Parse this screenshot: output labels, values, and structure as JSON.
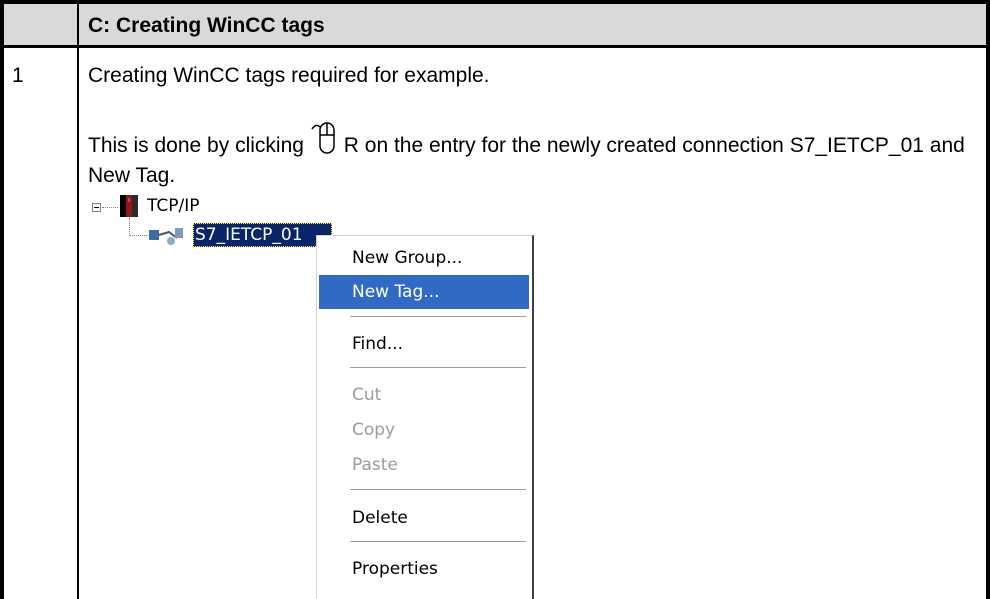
{
  "table": {
    "header_title": "C: Creating WinCC tags",
    "step_number": "1",
    "line1": "Creating WinCC tags required for example.",
    "line2_before": "This is done by clicking ",
    "line2_after": "R on the entry for the newly created connection S7_IETCP_01 and New Tag."
  },
  "tree": {
    "root_label": "TCP/IP",
    "child_label": "S7_IETCP_01",
    "root_icon": "network-unit-icon",
    "child_icon": "connection-icon",
    "expander": "collapse-minus-icon"
  },
  "context_menu": {
    "items": [
      {
        "label": "New Group...",
        "state": "normal"
      },
      {
        "label": "New Tag...",
        "state": "highlighted"
      },
      {
        "label": "Find...",
        "state": "normal"
      },
      {
        "label": "Cut",
        "state": "disabled"
      },
      {
        "label": "Copy",
        "state": "disabled"
      },
      {
        "label": "Paste",
        "state": "disabled"
      },
      {
        "label": "Delete",
        "state": "normal"
      },
      {
        "label": "Properties",
        "state": "normal"
      }
    ],
    "highlight_color": "#316ac5",
    "disabled_color": "#9c9c9c"
  },
  "colors": {
    "header_bg": "#d9d9d9",
    "selection_bg": "#0a246a"
  },
  "icons": {
    "mouse": "mouse-right-click-icon"
  }
}
